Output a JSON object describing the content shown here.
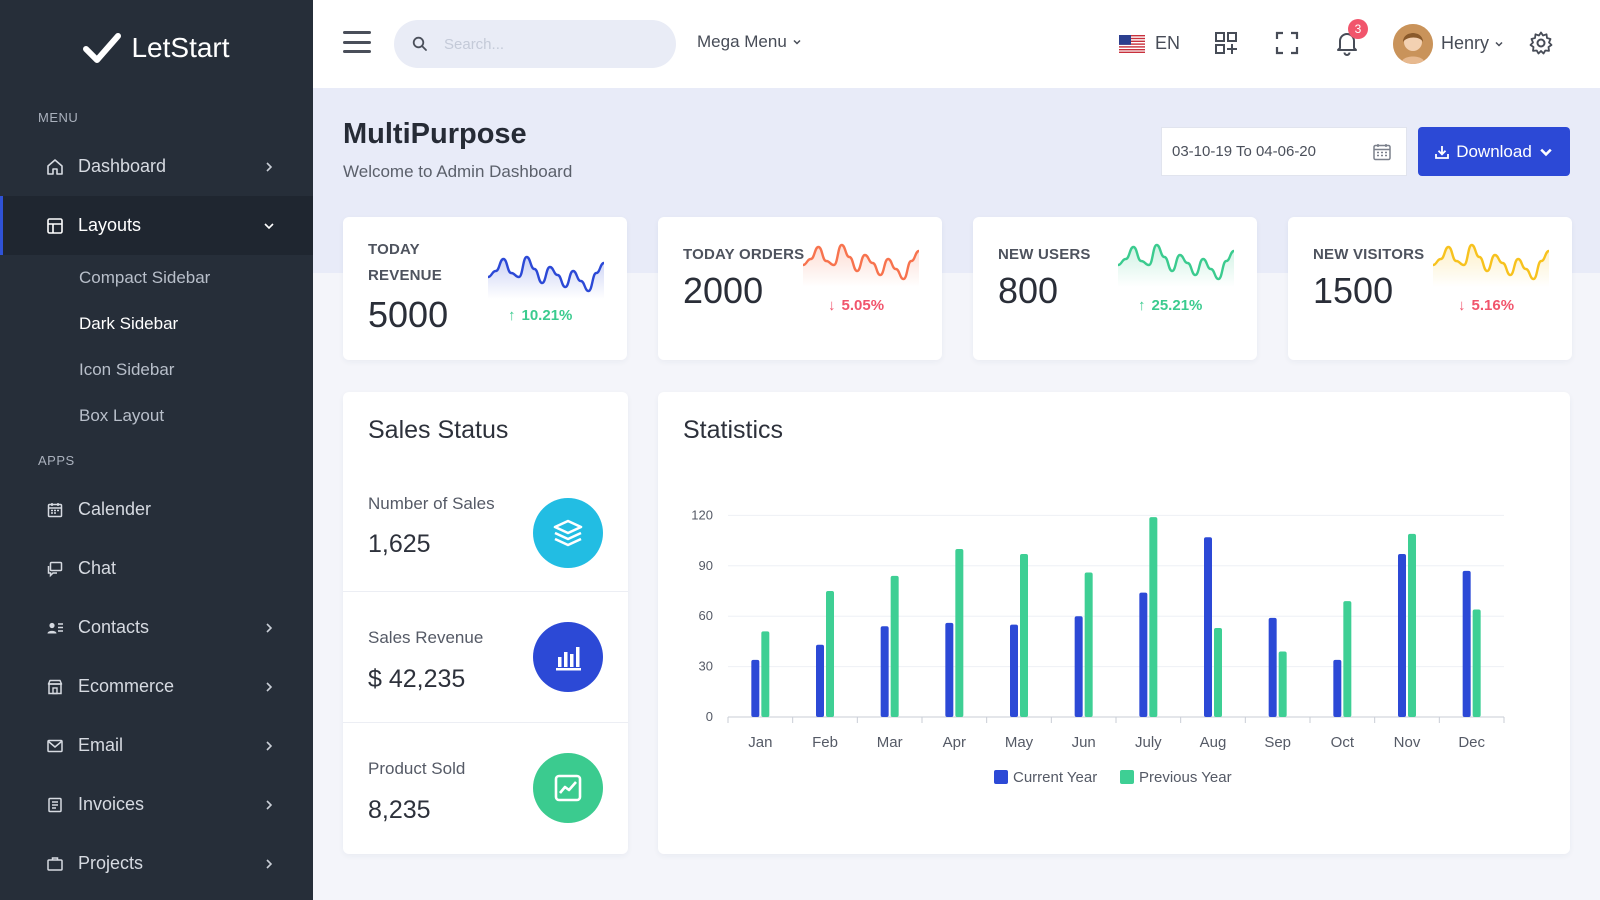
{
  "brand": {
    "name_part1": "Let",
    "name_part2": "Start",
    "icon": "check-icon"
  },
  "sidebar": {
    "menu_heading": "MENU",
    "apps_heading": "APPS",
    "menu_items": [
      {
        "label": "Dashboard",
        "icon": "home-icon"
      },
      {
        "label": "Layouts",
        "icon": "layout-icon"
      }
    ],
    "layouts_sub": [
      "Compact Sidebar",
      "Dark Sidebar",
      "Icon Sidebar",
      "Box Layout"
    ],
    "app_items": [
      {
        "label": "Calender",
        "icon": "calendar-icon"
      },
      {
        "label": "Chat",
        "icon": "chat-icon"
      },
      {
        "label": "Contacts",
        "icon": "contacts-icon"
      },
      {
        "label": "Ecommerce",
        "icon": "store-icon"
      },
      {
        "label": "Email",
        "icon": "mail-icon"
      },
      {
        "label": "Invoices",
        "icon": "invoice-icon"
      },
      {
        "label": "Projects",
        "icon": "projects-icon"
      }
    ]
  },
  "topbar": {
    "search_placeholder": "Search...",
    "mega_menu": "Mega Menu",
    "language": "EN",
    "notifications_count": "3",
    "user_name": "Henry"
  },
  "page": {
    "title": "MultiPurpose",
    "subtitle": "Welcome to Admin Dashboard",
    "date_range": "03-10-19 To 04-06-20",
    "download_label": "Download"
  },
  "stats": [
    {
      "label_line1": "TODAY",
      "label_line2": "REVENUE",
      "value": "5000",
      "pct": "10.21%",
      "trend": "up",
      "color": "#2c49d6"
    },
    {
      "label_line1": "TODAY ORDERS",
      "label_line2": "",
      "value": "2000",
      "pct": "5.05%",
      "trend": "down",
      "color": "#f7734e"
    },
    {
      "label_line1": "NEW USERS",
      "label_line2": "",
      "value": "800",
      "pct": "25.21%",
      "trend": "up",
      "color": "#3bcb8f"
    },
    {
      "label_line1": "NEW VISITORS",
      "label_line2": "",
      "value": "1500",
      "pct": "5.16%",
      "trend": "down",
      "color": "#f7c21e"
    }
  ],
  "sales_status": {
    "title": "Sales Status",
    "rows": [
      {
        "label": "Number of Sales",
        "value": "1,625",
        "icon": "layers-icon",
        "color": "#22bde3"
      },
      {
        "label": "Sales Revenue",
        "value": "$ 42,235",
        "icon": "bar-chart-icon",
        "color": "#2c49d6"
      },
      {
        "label": "Product Sold",
        "value": "8,235",
        "icon": "trend-chart-icon",
        "color": "#3bcb8f"
      }
    ]
  },
  "statistics": {
    "title": "Statistics"
  },
  "chart_data": {
    "type": "bar",
    "categories": [
      "Jan",
      "Feb",
      "Mar",
      "Apr",
      "May",
      "Jun",
      "July",
      "Aug",
      "Sep",
      "Oct",
      "Nov",
      "Dec"
    ],
    "series": [
      {
        "name": "Current Year",
        "color": "#2c49d6",
        "values": [
          34,
          43,
          54,
          56,
          55,
          60,
          74,
          107,
          59,
          34,
          97,
          87
        ]
      },
      {
        "name": "Previous Year",
        "color": "#3ecf94",
        "values": [
          51,
          75,
          84,
          100,
          97,
          86,
          119,
          53,
          39,
          69,
          109,
          64
        ]
      }
    ],
    "yticks": [
      0,
      30,
      60,
      90,
      120
    ],
    "ylim": [
      0,
      125
    ],
    "grid": true,
    "legend": "bottom"
  }
}
